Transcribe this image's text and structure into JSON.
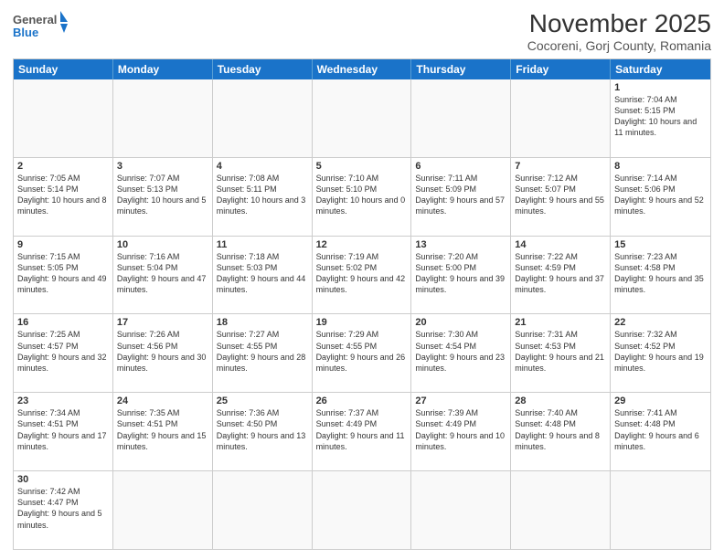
{
  "logo": {
    "general": "General",
    "blue": "Blue"
  },
  "header": {
    "title": "November 2025",
    "subtitle": "Cocoreni, Gorj County, Romania"
  },
  "weekdays": [
    "Sunday",
    "Monday",
    "Tuesday",
    "Wednesday",
    "Thursday",
    "Friday",
    "Saturday"
  ],
  "rows": [
    [
      {
        "day": "",
        "info": ""
      },
      {
        "day": "",
        "info": ""
      },
      {
        "day": "",
        "info": ""
      },
      {
        "day": "",
        "info": ""
      },
      {
        "day": "",
        "info": ""
      },
      {
        "day": "",
        "info": ""
      },
      {
        "day": "1",
        "info": "Sunrise: 7:04 AM\nSunset: 5:15 PM\nDaylight: 10 hours and 11 minutes."
      }
    ],
    [
      {
        "day": "2",
        "info": "Sunrise: 7:05 AM\nSunset: 5:14 PM\nDaylight: 10 hours and 8 minutes."
      },
      {
        "day": "3",
        "info": "Sunrise: 7:07 AM\nSunset: 5:13 PM\nDaylight: 10 hours and 5 minutes."
      },
      {
        "day": "4",
        "info": "Sunrise: 7:08 AM\nSunset: 5:11 PM\nDaylight: 10 hours and 3 minutes."
      },
      {
        "day": "5",
        "info": "Sunrise: 7:10 AM\nSunset: 5:10 PM\nDaylight: 10 hours and 0 minutes."
      },
      {
        "day": "6",
        "info": "Sunrise: 7:11 AM\nSunset: 5:09 PM\nDaylight: 9 hours and 57 minutes."
      },
      {
        "day": "7",
        "info": "Sunrise: 7:12 AM\nSunset: 5:07 PM\nDaylight: 9 hours and 55 minutes."
      },
      {
        "day": "8",
        "info": "Sunrise: 7:14 AM\nSunset: 5:06 PM\nDaylight: 9 hours and 52 minutes."
      }
    ],
    [
      {
        "day": "9",
        "info": "Sunrise: 7:15 AM\nSunset: 5:05 PM\nDaylight: 9 hours and 49 minutes."
      },
      {
        "day": "10",
        "info": "Sunrise: 7:16 AM\nSunset: 5:04 PM\nDaylight: 9 hours and 47 minutes."
      },
      {
        "day": "11",
        "info": "Sunrise: 7:18 AM\nSunset: 5:03 PM\nDaylight: 9 hours and 44 minutes."
      },
      {
        "day": "12",
        "info": "Sunrise: 7:19 AM\nSunset: 5:02 PM\nDaylight: 9 hours and 42 minutes."
      },
      {
        "day": "13",
        "info": "Sunrise: 7:20 AM\nSunset: 5:00 PM\nDaylight: 9 hours and 39 minutes."
      },
      {
        "day": "14",
        "info": "Sunrise: 7:22 AM\nSunset: 4:59 PM\nDaylight: 9 hours and 37 minutes."
      },
      {
        "day": "15",
        "info": "Sunrise: 7:23 AM\nSunset: 4:58 PM\nDaylight: 9 hours and 35 minutes."
      }
    ],
    [
      {
        "day": "16",
        "info": "Sunrise: 7:25 AM\nSunset: 4:57 PM\nDaylight: 9 hours and 32 minutes."
      },
      {
        "day": "17",
        "info": "Sunrise: 7:26 AM\nSunset: 4:56 PM\nDaylight: 9 hours and 30 minutes."
      },
      {
        "day": "18",
        "info": "Sunrise: 7:27 AM\nSunset: 4:55 PM\nDaylight: 9 hours and 28 minutes."
      },
      {
        "day": "19",
        "info": "Sunrise: 7:29 AM\nSunset: 4:55 PM\nDaylight: 9 hours and 26 minutes."
      },
      {
        "day": "20",
        "info": "Sunrise: 7:30 AM\nSunset: 4:54 PM\nDaylight: 9 hours and 23 minutes."
      },
      {
        "day": "21",
        "info": "Sunrise: 7:31 AM\nSunset: 4:53 PM\nDaylight: 9 hours and 21 minutes."
      },
      {
        "day": "22",
        "info": "Sunrise: 7:32 AM\nSunset: 4:52 PM\nDaylight: 9 hours and 19 minutes."
      }
    ],
    [
      {
        "day": "23",
        "info": "Sunrise: 7:34 AM\nSunset: 4:51 PM\nDaylight: 9 hours and 17 minutes."
      },
      {
        "day": "24",
        "info": "Sunrise: 7:35 AM\nSunset: 4:51 PM\nDaylight: 9 hours and 15 minutes."
      },
      {
        "day": "25",
        "info": "Sunrise: 7:36 AM\nSunset: 4:50 PM\nDaylight: 9 hours and 13 minutes."
      },
      {
        "day": "26",
        "info": "Sunrise: 7:37 AM\nSunset: 4:49 PM\nDaylight: 9 hours and 11 minutes."
      },
      {
        "day": "27",
        "info": "Sunrise: 7:39 AM\nSunset: 4:49 PM\nDaylight: 9 hours and 10 minutes."
      },
      {
        "day": "28",
        "info": "Sunrise: 7:40 AM\nSunset: 4:48 PM\nDaylight: 9 hours and 8 minutes."
      },
      {
        "day": "29",
        "info": "Sunrise: 7:41 AM\nSunset: 4:48 PM\nDaylight: 9 hours and 6 minutes."
      }
    ],
    [
      {
        "day": "30",
        "info": "Sunrise: 7:42 AM\nSunset: 4:47 PM\nDaylight: 9 hours and 5 minutes."
      },
      {
        "day": "",
        "info": ""
      },
      {
        "day": "",
        "info": ""
      },
      {
        "day": "",
        "info": ""
      },
      {
        "day": "",
        "info": ""
      },
      {
        "day": "",
        "info": ""
      },
      {
        "day": "",
        "info": ""
      }
    ]
  ]
}
